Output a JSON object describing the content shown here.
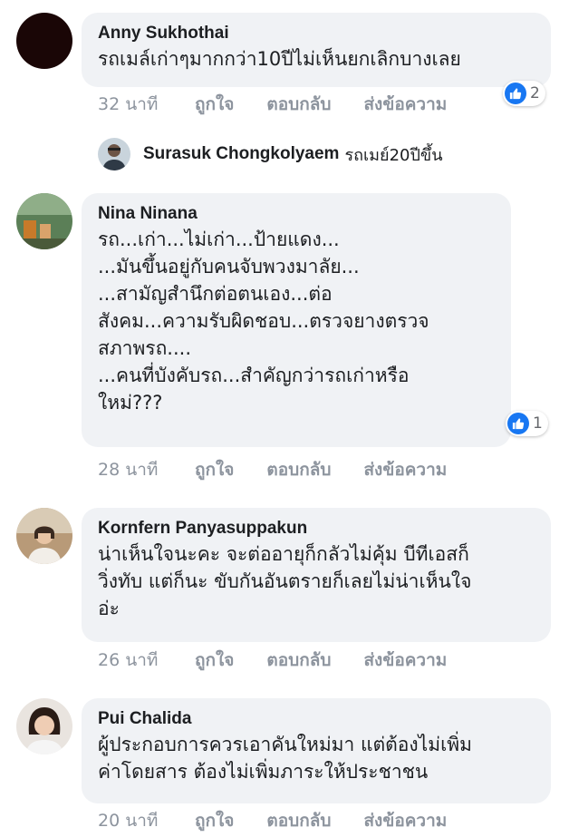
{
  "comments": [
    {
      "author": "Anny Sukhothai",
      "text": "รถเมล์เก่าๆมากกว่า10ปีไม่เห็นยกเลิกบางเลย",
      "time": "32 นาที",
      "like_label": "ถูกใจ",
      "reply_label": "ตอบกลับ",
      "message_label": "ส่งข้อความ",
      "reaction_count": "2"
    },
    {
      "author": "Nina Ninana",
      "text": "รถ...เก่า...ไม่เก่า...ป้ายแดง...\n...มันขึ้นอยู่กับคนจับพวงมาลัย...\n...สามัญสำนึกต่อตนเอง...ต่อ\nสังคม...ความรับผิดชอบ...ตรวจยางตรวจ\nสภาพรถ....\n...คนที่บังคับรถ...สำคัญกว่ารถเก่าหรือ\nใหม่???",
      "time": "28 นาที",
      "like_label": "ถูกใจ",
      "reply_label": "ตอบกลับ",
      "message_label": "ส่งข้อความ",
      "reaction_count": "1"
    },
    {
      "author": "Kornfern Panyasuppakun",
      "text": "น่าเห็นใจนะคะ จะต่ออายุก็กลัวไม่คุ้ม  บีทีเอสก็\nวิ่งทับ แต่ก็นะ ขับกันอันตรายก็เลยไม่น่าเห็นใจ\nอ่ะ",
      "time": "26 นาที",
      "like_label": "ถูกใจ",
      "reply_label": "ตอบกลับ",
      "message_label": "ส่งข้อความ"
    },
    {
      "author": "Pui Chalida",
      "text": "ผู้ประกอบการควรเอาคันใหม่มา แต่ต้องไม่เพิ่ม\nค่าโดยสาร ต้องไม่เพิ่มภาระให้ประชาชน",
      "time": "20 นาที",
      "like_label": "ถูกใจ",
      "reply_label": "ตอบกลับ",
      "message_label": "ส่งข้อความ"
    }
  ],
  "reply_preview": {
    "author": "Surasuk Chongkolyaem",
    "text": "รถเมย์20ปีขึ้น"
  },
  "colors": {
    "bubble": "#f0f2f5",
    "like_blue": "#1877f2",
    "meta_gray": "#8d949e"
  }
}
